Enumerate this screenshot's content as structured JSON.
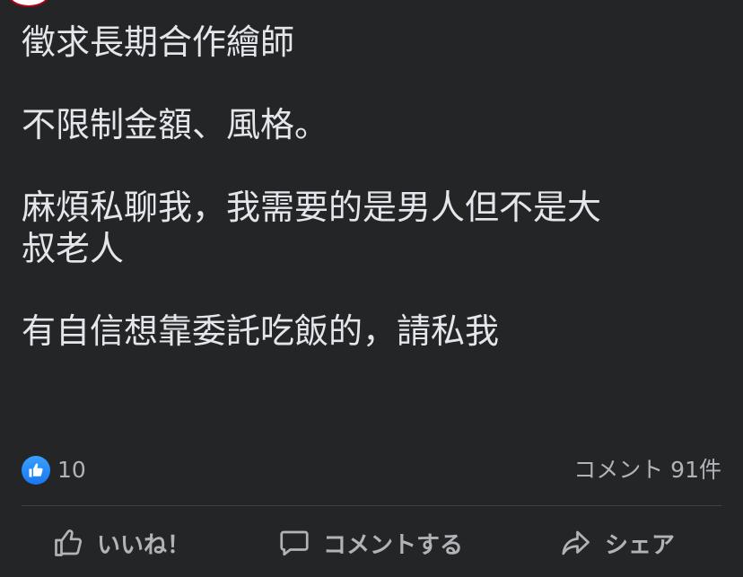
{
  "post": {
    "lines": [
      "徵求長期合作繪師",
      "",
      "不限制金額、風格。",
      "",
      "麻煩私聊我，我需要的是男人但不是大",
      "叔老人",
      "",
      "有自信想靠委託吃飯的，請私我"
    ]
  },
  "reactions": {
    "icon": "thumbs-up-icon",
    "count": "10",
    "comments_label": "コメント 91件"
  },
  "actions": {
    "like_label": "いいね！",
    "comment_label": "コメントする",
    "share_label": "シェア"
  },
  "colors": {
    "background": "#242526",
    "text": "#e4e6eb",
    "muted": "#b0b3b8",
    "like_blue": "#1877f2",
    "divider": "#3e4042"
  }
}
